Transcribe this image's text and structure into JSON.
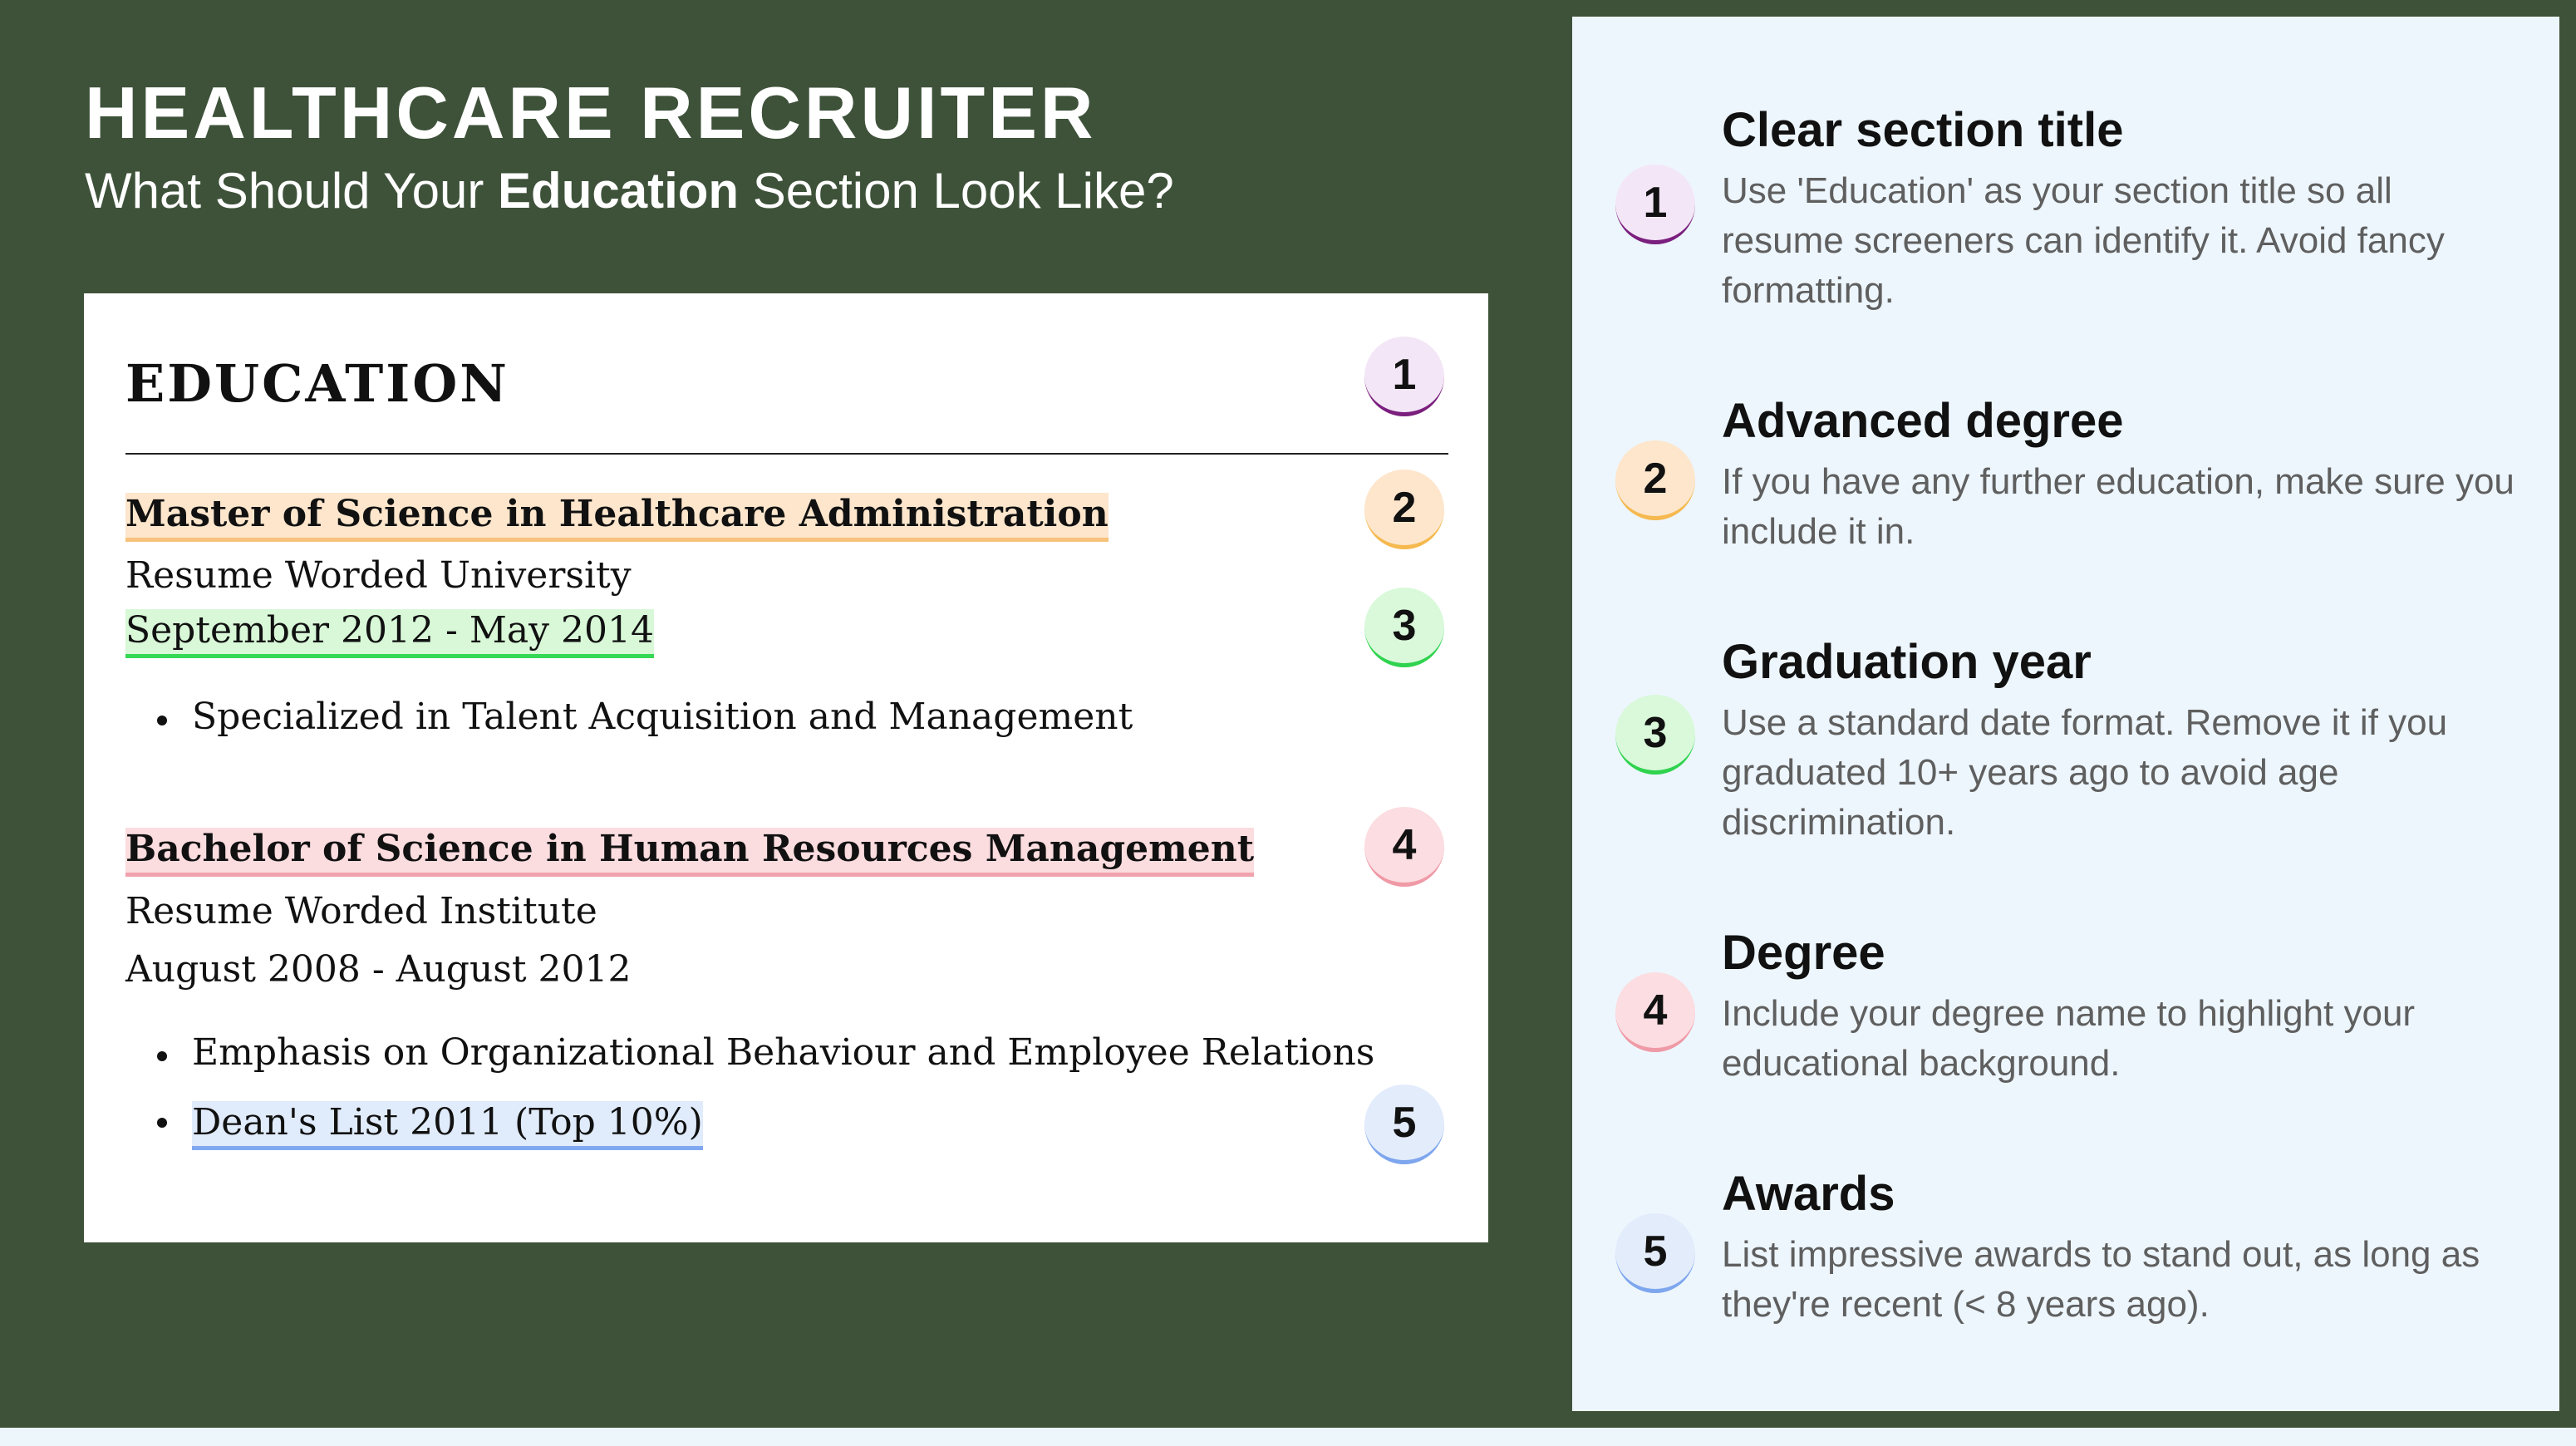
{
  "header": {
    "title": "HEALTHCARE RECRUITER",
    "subtitle_prefix": "What Should Your ",
    "subtitle_bold": "Education",
    "subtitle_suffix": " Section Look Like?"
  },
  "resume": {
    "section_title": "EDUCATION",
    "entries": [
      {
        "degree": "Master of Science in Healthcare Administration",
        "school": "Resume Worded University",
        "dates": "September 2012 - May 2014",
        "bullets": [
          "Specialized in Talent Acquisition and Management"
        ]
      },
      {
        "degree": "Bachelor of Science in Human Resources Management",
        "school": "Resume Worded Institute",
        "dates": "August 2008 - August 2012",
        "bullets": [
          "Emphasis on Organizational Behaviour and Employee Relations",
          "Dean's List 2011 (Top 10%)"
        ]
      }
    ],
    "badges": [
      "1",
      "2",
      "3",
      "4",
      "5"
    ]
  },
  "tips": [
    {
      "number": "1",
      "title": "Clear section title",
      "body": "Use 'Education' as your section title so all resume screeners can identify it. Avoid fancy formatting.",
      "color": "#7b1f7e"
    },
    {
      "number": "2",
      "title": "Advanced degree",
      "body": "If you have any further education, make sure you include it in.",
      "color": "#f5b94f"
    },
    {
      "number": "3",
      "title": "Graduation year",
      "body": "Use a standard date format. Remove it if you graduated 10+ years ago to avoid age discrimination.",
      "color": "#2fd34e"
    },
    {
      "number": "4",
      "title": "Degree",
      "body": "Include your degree name to highlight your educational background.",
      "color": "#ef9aa6"
    },
    {
      "number": "5",
      "title": "Awards",
      "body": "List impressive awards to stand out, as long as they're recent (< 8 years ago).",
      "color": "#7ea6ee"
    }
  ],
  "colors": {
    "background": "#3e523a",
    "card": "#ffffff",
    "tips_panel": "#edf6fd"
  }
}
